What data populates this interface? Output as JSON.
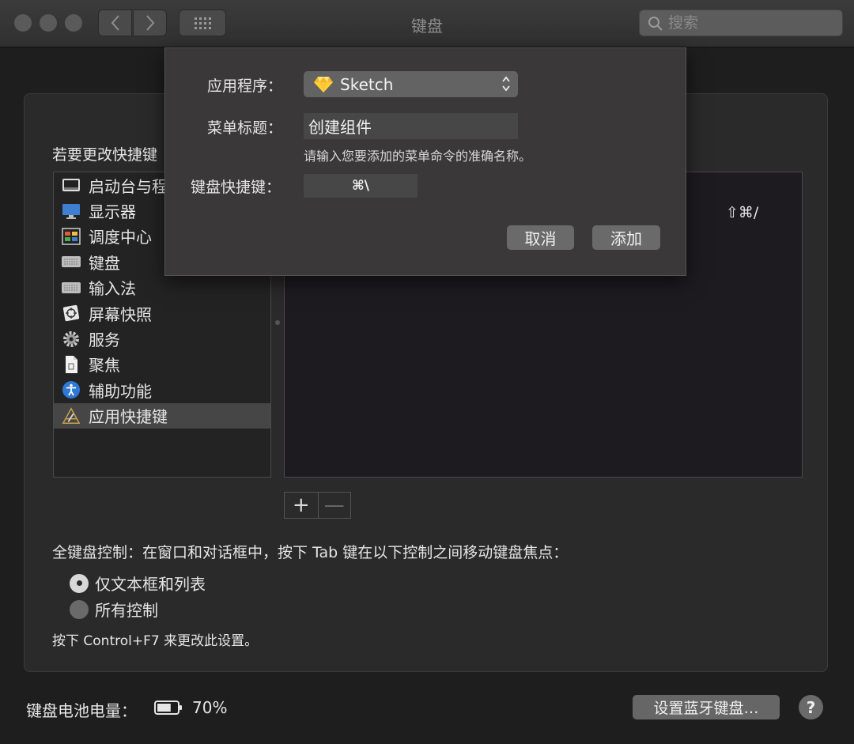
{
  "window": {
    "title": "键盘"
  },
  "search": {
    "placeholder": "搜索"
  },
  "main": {
    "instruction": "若要更改快捷键",
    "sidebar": {
      "items": [
        {
          "label": "启动台与程",
          "icon": "launchpad-icon"
        },
        {
          "label": "显示器",
          "icon": "display-icon"
        },
        {
          "label": "调度中心",
          "icon": "mission-control-icon"
        },
        {
          "label": "键盘",
          "icon": "keyboard-icon"
        },
        {
          "label": "输入法",
          "icon": "input-method-icon"
        },
        {
          "label": "屏幕快照",
          "icon": "screenshot-icon"
        },
        {
          "label": "服务",
          "icon": "gear-icon"
        },
        {
          "label": "聚焦",
          "icon": "spotlight-icon"
        },
        {
          "label": "辅助功能",
          "icon": "accessibility-icon"
        },
        {
          "label": "应用快捷键",
          "icon": "app-shortcuts-icon",
          "selected": true
        }
      ]
    },
    "shortcut_value": "⇧⌘/",
    "add_label": "+",
    "remove_label": "—",
    "full_keyboard_control": "全键盘控制：在窗口和对话框中，按下 Tab 键在以下控制之间移动键盘焦点：",
    "radio_options": [
      {
        "label": "仅文本框和列表",
        "selected": true
      },
      {
        "label": "所有控制",
        "selected": false
      }
    ],
    "hint": "按下 Control+F7 来更改此设置。"
  },
  "footer": {
    "battery_label": "键盘电池电量：",
    "battery_percent": "70%",
    "battery_level": 0.7,
    "bluetooth_button": "设置蓝牙键盘…",
    "help_label": "?"
  },
  "sheet": {
    "app_label": "应用程序：",
    "app_value": "Sketch",
    "menu_title_label": "菜单标题：",
    "menu_title_value": "创建组件",
    "menu_title_hint": "请输入您要添加的菜单命令的准确名称。",
    "shortcut_label": "键盘快捷键：",
    "shortcut_value": "⌘\\",
    "cancel_label": "取消",
    "add_label": "添加"
  },
  "colors": {
    "background": "#1e1e1e",
    "panel": "#2a2a2a",
    "selected_row": "#464646",
    "sketch_gem": "#f7b52c"
  }
}
